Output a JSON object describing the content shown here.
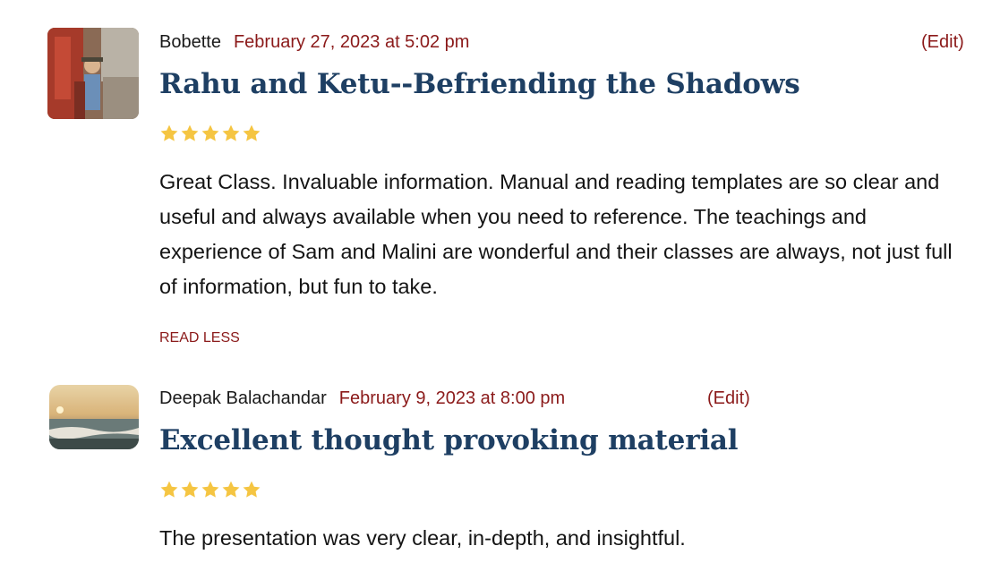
{
  "reviews": [
    {
      "author": "Bobette",
      "date": "February 27, 2023 at 5:02 pm",
      "edit_label": "(Edit)",
      "title": "Rahu and Ketu--Befriending the Shadows",
      "rating": 5,
      "rating_max": 5,
      "body": "Great Class. Invaluable information. Manual and reading templates are so clear and useful and always available when you need to reference. The teachings and experience of Sam and Malini are wonderful and their classes are always, not just full of information, but fun to take.",
      "toggle_label": "READ LESS",
      "avatar_icon": "user-photo-avatar"
    },
    {
      "author": "Deepak Balachandar",
      "date": "February 9, 2023 at 8:00 pm",
      "edit_label": "(Edit)",
      "title": "Excellent thought provoking material",
      "rating": 5,
      "rating_max": 5,
      "body": "The presentation was very clear, in-depth, and insightful.",
      "avatar_icon": "sunset-photo-avatar"
    }
  ],
  "colors": {
    "title": "#1e3f63",
    "accent_red": "#8b1a1a",
    "star": "#f5c542",
    "text": "#141414"
  }
}
